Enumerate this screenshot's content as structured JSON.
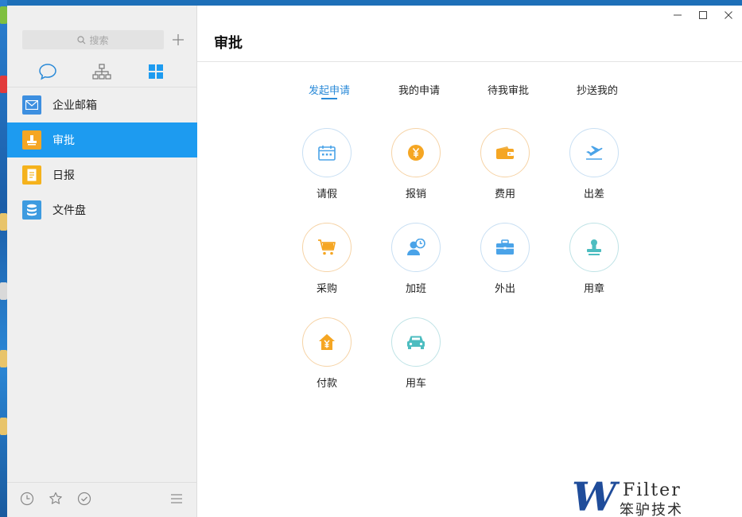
{
  "sidebar": {
    "search_placeholder": "搜索",
    "items": [
      {
        "label": "企业邮箱",
        "icon": "mail-icon",
        "color": "#3d8fe0"
      },
      {
        "label": "审批",
        "icon": "stamp-icon",
        "color": "#f5a623",
        "active": true
      },
      {
        "label": "日报",
        "icon": "report-icon",
        "color": "#f5b21c"
      },
      {
        "label": "文件盘",
        "icon": "database-icon",
        "color": "#3d9be0"
      }
    ]
  },
  "main": {
    "title": "审批",
    "tabs": [
      {
        "label": "发起申请",
        "active": true
      },
      {
        "label": "我的申请"
      },
      {
        "label": "待我审批"
      },
      {
        "label": "抄送我的"
      }
    ],
    "apps": [
      {
        "label": "请假",
        "icon": "calendar-icon"
      },
      {
        "label": "报销",
        "icon": "yuan-coin-icon"
      },
      {
        "label": "费用",
        "icon": "wallet-icon"
      },
      {
        "label": "出差",
        "icon": "airplane-icon"
      },
      {
        "label": "采购",
        "icon": "cart-icon"
      },
      {
        "label": "加班",
        "icon": "overtime-icon"
      },
      {
        "label": "外出",
        "icon": "briefcase-icon"
      },
      {
        "label": "用章",
        "icon": "seal-icon"
      },
      {
        "label": "付款",
        "icon": "payment-house-icon"
      },
      {
        "label": "用车",
        "icon": "car-icon"
      }
    ]
  },
  "colors": {
    "accent": "#1d9bf0",
    "tab_active": "#2a8ad8",
    "orange": "#f5a623",
    "blue": "#4aa3e8",
    "teal": "#4dbdc0"
  },
  "watermark": {
    "filter": "Filter",
    "cn": "笨驴技术"
  }
}
